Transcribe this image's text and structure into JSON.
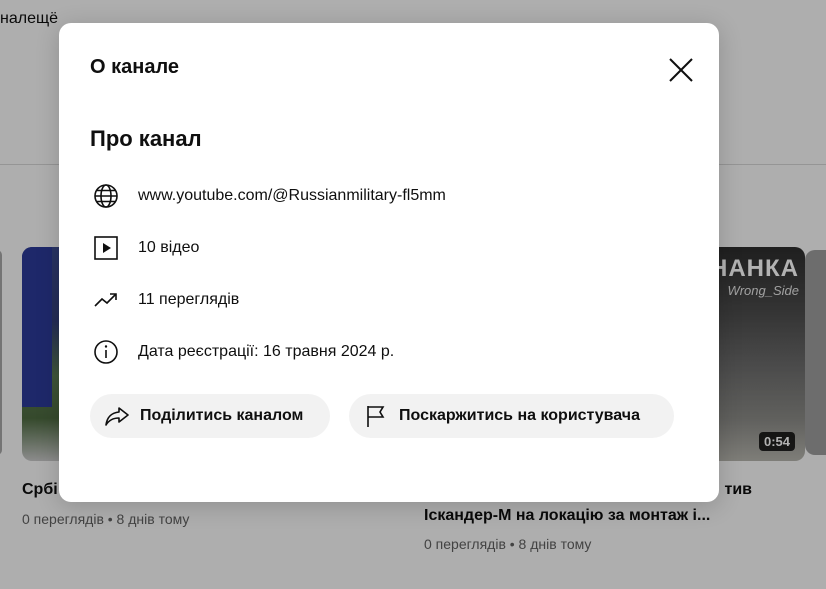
{
  "background": {
    "top_text": "налещё",
    "videos": [
      {
        "title": "Србі",
        "meta": "0 переглядів • 8 днів тому"
      },
      {
        "title_line1": "тив",
        "title_line2": "Іскандер-М на локацію за монтаж і...",
        "meta": "0 переглядів • 8 днів тому",
        "duration": "0:54",
        "thumb_banner": "НАНКА",
        "thumb_sub": "Wrong_Side"
      }
    ]
  },
  "dialog": {
    "title": "О канале",
    "close_icon": "close-icon",
    "section_title": "Про канал",
    "details": [
      {
        "icon": "globe-icon",
        "text": "www.youtube.com/@Russianmilitary-fl5mm"
      },
      {
        "icon": "play-icon",
        "text": "10 відео"
      },
      {
        "icon": "trending-icon",
        "text": "11 переглядів"
      },
      {
        "icon": "info-icon",
        "text": "Дата реєстрації: 16 травня 2024 р."
      }
    ],
    "buttons": {
      "share": {
        "icon": "share-icon",
        "label": "Поділитись каналом"
      },
      "report": {
        "icon": "flag-icon",
        "label": "Поскаржитись на користувача"
      }
    }
  },
  "colors": {
    "overlay": "#000000",
    "dialog_bg": "#ffffff",
    "button_bg": "#f2f2f2",
    "meta_text": "#606060"
  }
}
